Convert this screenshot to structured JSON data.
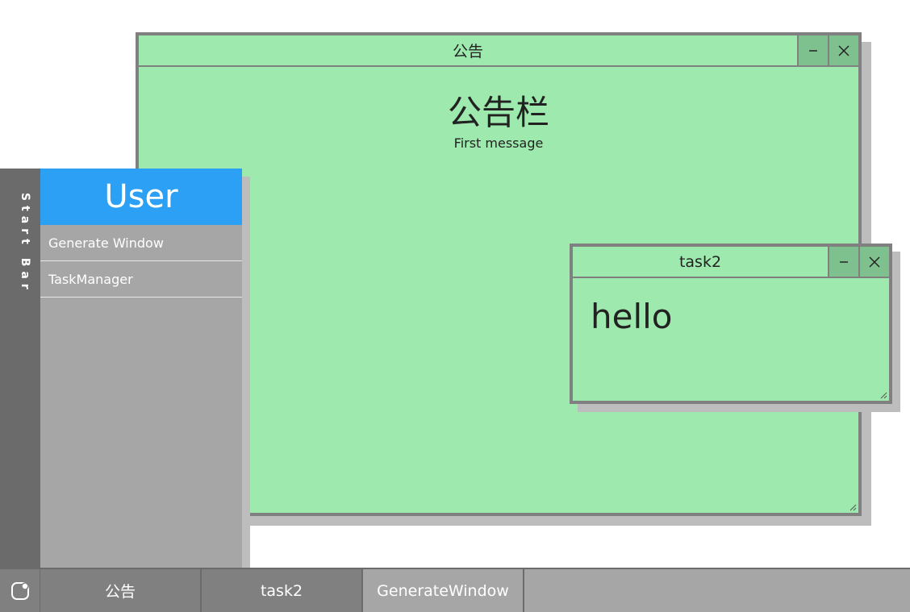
{
  "colors": {
    "window_bg": "#9eeaae",
    "window_border": "#808080",
    "titlebar_button": "#7fc08f",
    "menu_header": "#2ca0f5",
    "menu_bg": "#a6a6a6",
    "startbar_bg": "#6b6b6b",
    "taskbar_bg": "#a6a6a6"
  },
  "notice_window": {
    "title": "公告",
    "minimize_icon": "minimize-icon",
    "close_icon": "close-icon",
    "heading": "公告栏",
    "message": "First message"
  },
  "task2_window": {
    "title": "task2",
    "minimize_icon": "minimize-icon",
    "close_icon": "close-icon",
    "content": "hello"
  },
  "start_bar": {
    "label": "Start Bar"
  },
  "start_menu": {
    "header": "User",
    "items": [
      {
        "label": "Generate Window"
      },
      {
        "label": "TaskManager"
      }
    ]
  },
  "taskbar": {
    "start_icon": "start-icon",
    "tasks": [
      {
        "label": "公告",
        "active": true
      },
      {
        "label": "task2",
        "active": true
      },
      {
        "label": "GenerateWindow",
        "active": false
      }
    ]
  }
}
